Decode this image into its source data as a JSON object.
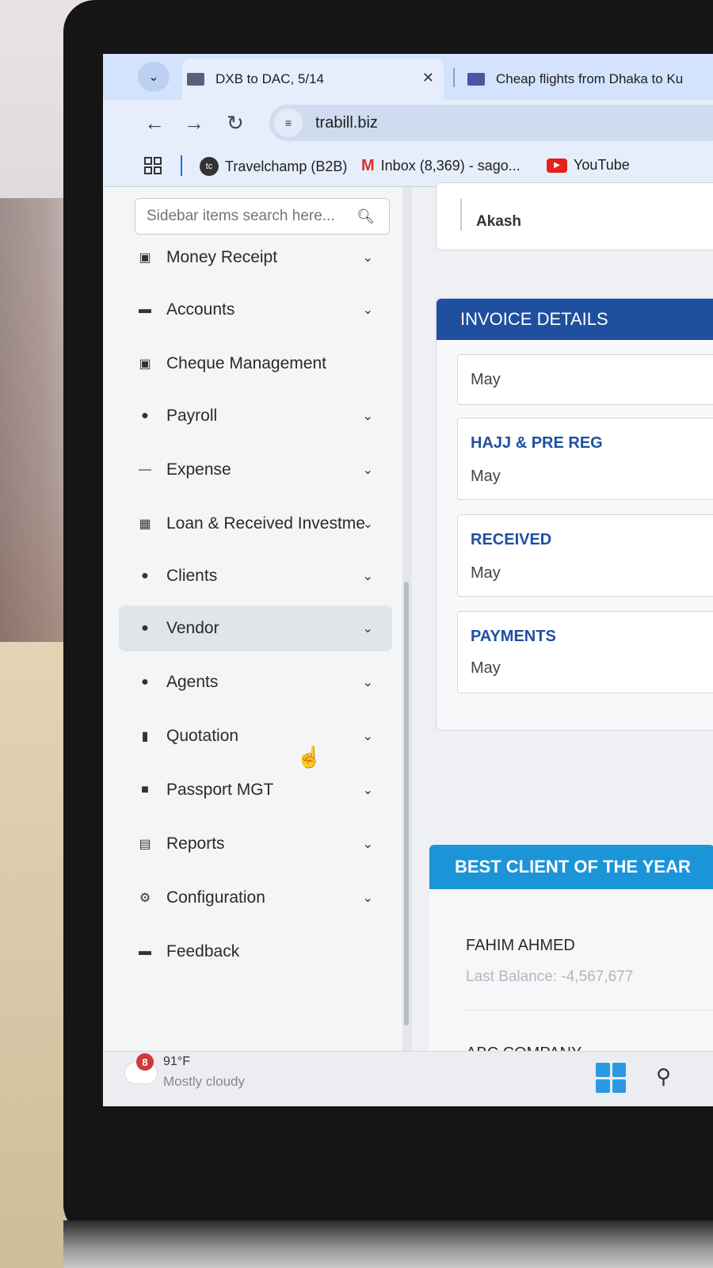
{
  "browser": {
    "tabs": [
      {
        "title": "DXB to DAC, 5/14",
        "favicon_color": "#5a5f7a"
      },
      {
        "title": "Cheap flights from Dhaka to Ku",
        "favicon_color": "#4a54a0"
      }
    ],
    "url": "trabill.biz",
    "bookmarks": [
      {
        "label": "Travelchamp (B2B)",
        "icon": "travelchamp-logo-icon"
      },
      {
        "label": "Inbox (8,369) - sago...",
        "icon": "gmail-icon"
      },
      {
        "label": "YouTube",
        "icon": "youtube-icon"
      }
    ]
  },
  "sidebar": {
    "search_placeholder": "Sidebar items search here...",
    "items": [
      {
        "label": "Money Receipt",
        "icon": "receipt-icon",
        "has_chevron": true
      },
      {
        "label": "Accounts",
        "icon": "card-icon",
        "has_chevron": true
      },
      {
        "label": "Cheque Management",
        "icon": "cheque-icon",
        "has_chevron": false
      },
      {
        "label": "Payroll",
        "icon": "user-icon",
        "has_chevron": true
      },
      {
        "label": "Expense",
        "icon": "minus-icon",
        "has_chevron": true
      },
      {
        "label": "Loan & Received Investme",
        "icon": "loan-icon",
        "has_chevron": true
      },
      {
        "label": "Clients",
        "icon": "user-icon",
        "has_chevron": true
      },
      {
        "label": "Vendor",
        "icon": "user-icon",
        "has_chevron": true,
        "active": true
      },
      {
        "label": "Agents",
        "icon": "user-icon",
        "has_chevron": true
      },
      {
        "label": "Quotation",
        "icon": "document-icon",
        "has_chevron": true
      },
      {
        "label": "Passport MGT",
        "icon": "passport-icon",
        "has_chevron": true
      },
      {
        "label": "Reports",
        "icon": "report-icon",
        "has_chevron": true
      },
      {
        "label": "Configuration",
        "icon": "gear-icon",
        "has_chevron": true
      },
      {
        "label": "Feedback",
        "icon": "comment-icon",
        "has_chevron": false
      }
    ]
  },
  "main": {
    "top_card_name": "Akash",
    "invoice_details": {
      "title": "INVOICE DETAILS",
      "cards": [
        {
          "title": "",
          "month": "May"
        },
        {
          "title": "HAJJ & PRE REG",
          "month": "May"
        },
        {
          "title": "RECEIVED",
          "month": "May"
        },
        {
          "title": "PAYMENTS",
          "month": "May"
        }
      ]
    },
    "best_client": {
      "title": "BEST CLIENT OF THE YEAR",
      "clients": [
        {
          "name": "FAHIM AHMED",
          "balance": "Last Balance: -4,567,677"
        },
        {
          "name": "ABC COMPANY",
          "balance": ""
        }
      ]
    }
  },
  "taskbar": {
    "weather_badge": "8",
    "temperature": "91°F",
    "condition": "Mostly cloudy"
  },
  "colors": {
    "invoice_header": "#1f4f9f",
    "best_client_header": "#1c94d8",
    "tab_strip": "#d3e3fd"
  }
}
